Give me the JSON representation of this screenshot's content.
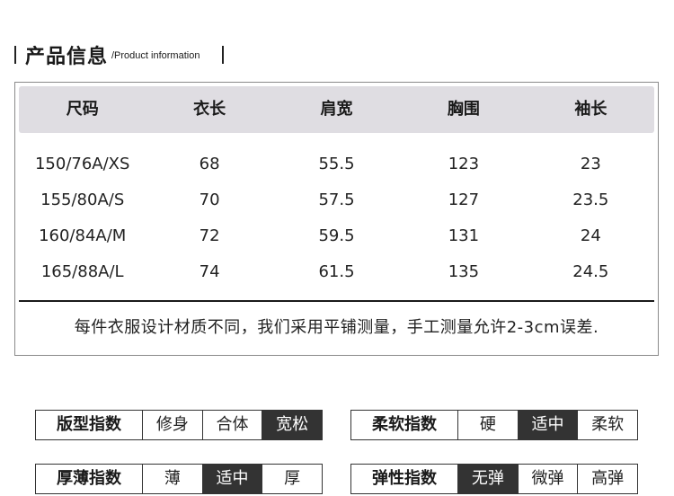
{
  "header": {
    "title": "产品信息",
    "subtitle": "/Product information"
  },
  "size_table": {
    "columns": [
      "尺码",
      "衣长",
      "肩宽",
      "胸围",
      "袖长"
    ],
    "rows": [
      [
        "150/76A/XS",
        "68",
        "55.5",
        "123",
        "23"
      ],
      [
        "155/80A/S",
        "70",
        "57.5",
        "127",
        "23.5"
      ],
      [
        "160/84A/M",
        "72",
        "59.5",
        "131",
        "24"
      ],
      [
        "165/88A/L",
        "74",
        "61.5",
        "135",
        "24.5"
      ]
    ],
    "note": "每件衣服设计材质不同，我们采用平铺测量，手工测量允许2-3cm误差."
  },
  "indicators": [
    {
      "label": "版型指数",
      "options": [
        "修身",
        "合体",
        "宽松"
      ],
      "selected": "宽松"
    },
    {
      "label": "柔软指数",
      "options": [
        "硬",
        "适中",
        "柔软"
      ],
      "selected": "适中"
    },
    {
      "label": "厚薄指数",
      "options": [
        "薄",
        "适中",
        "厚"
      ],
      "selected": "适中"
    },
    {
      "label": "弹性指数",
      "options": [
        "无弹",
        "微弹",
        "高弹"
      ],
      "selected": "无弹"
    }
  ],
  "colors": {
    "header_band": "#dfdde2",
    "selected_bg": "#333333",
    "selected_text": "#ffffff"
  }
}
